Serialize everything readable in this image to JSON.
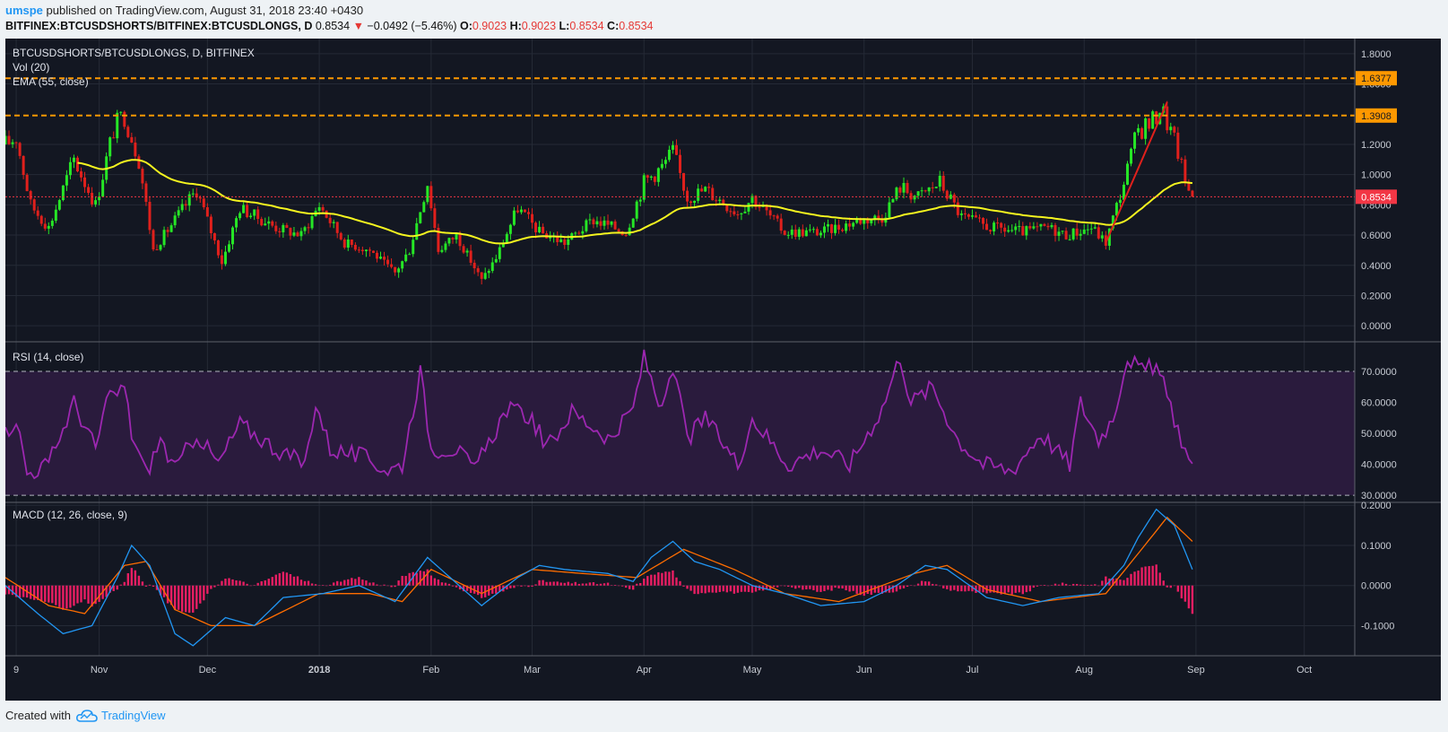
{
  "header": {
    "author": "umspe",
    "published_text": "published on TradingView.com, August 31, 2018 23:40 +0430",
    "symbol": "BITFINEX:BTCUSDSHORTS/BITFINEX:BTCUSDLONGS, D",
    "last": "0.8534",
    "change": "−0.0492 (−5.46%)",
    "o_label": "O:",
    "o_value": "0.9023",
    "h_label": "H:",
    "h_value": "0.9023",
    "l_label": "L:",
    "l_value": "0.8534",
    "c_label": "C:",
    "c_value": "0.8534"
  },
  "footer": {
    "created_with": "Created with",
    "brand": "TradingView"
  },
  "colors": {
    "background": "#131722",
    "up": "#26e626",
    "down": "#e0201c",
    "ema": "#f5f51f",
    "level": "#ff9800",
    "rsi": "#9c27b0",
    "rsi_band": "#2a1b3d",
    "macd": "#2196f3",
    "signal": "#ff6d00",
    "histogram": "#e91e63",
    "last_price": "#f23645"
  },
  "chart_data": [
    {
      "type": "candlestick",
      "title": "BTCUSDSHORTS/BTCUSDLONGS, D, BITFINEX",
      "indicators": [
        "Vol (20)",
        "EMA (55, close)"
      ],
      "x_ticks": [
        "9",
        "Nov",
        "Dec",
        "2018",
        "Feb",
        "Mar",
        "Apr",
        "May",
        "Jun",
        "Jul",
        "Aug",
        "Sep",
        "Oct"
      ],
      "y_ticks": [
        "1.8000",
        "1.6000",
        "1.2000",
        "1.0000",
        "0.8000",
        "0.6000",
        "0.4000",
        "0.2000",
        "0.0000"
      ],
      "ylim": [
        -0.1,
        1.9
      ],
      "horizontal_levels": [
        {
          "value": 1.6377,
          "label": "1.6377"
        },
        {
          "value": 1.3908,
          "label": "1.3908"
        }
      ],
      "last_price": {
        "value": 0.8534,
        "label": "0.8534"
      },
      "close_anchors": [
        [
          "2017-10-06",
          1.2
        ],
        [
          "2017-10-09",
          1.25
        ],
        [
          "2017-10-13",
          0.8
        ],
        [
          "2017-10-18",
          0.65
        ],
        [
          "2017-10-25",
          1.1
        ],
        [
          "2017-10-31",
          0.8
        ],
        [
          "2017-11-05",
          1.3
        ],
        [
          "2017-11-08",
          1.4
        ],
        [
          "2017-11-12",
          1.1
        ],
        [
          "2017-11-16",
          0.5
        ],
        [
          "2017-11-22",
          0.7
        ],
        [
          "2017-11-28",
          0.9
        ],
        [
          "2017-12-05",
          0.42
        ],
        [
          "2017-12-10",
          0.78
        ],
        [
          "2017-12-20",
          0.65
        ],
        [
          "2017-12-27",
          0.6
        ],
        [
          "2018-01-01",
          0.8
        ],
        [
          "2018-01-08",
          0.55
        ],
        [
          "2018-01-15",
          0.5
        ],
        [
          "2018-01-22",
          0.35
        ],
        [
          "2018-01-26",
          0.5
        ],
        [
          "2018-01-31",
          0.95
        ],
        [
          "2018-02-03",
          0.5
        ],
        [
          "2018-02-08",
          0.6
        ],
        [
          "2018-02-15",
          0.3
        ],
        [
          "2018-02-19",
          0.45
        ],
        [
          "2018-02-25",
          0.78
        ],
        [
          "2018-03-03",
          0.62
        ],
        [
          "2018-03-10",
          0.55
        ],
        [
          "2018-03-18",
          0.7
        ],
        [
          "2018-03-27",
          0.62
        ],
        [
          "2018-04-01",
          0.95
        ],
        [
          "2018-04-06",
          1.05
        ],
        [
          "2018-04-09",
          1.15
        ],
        [
          "2018-04-13",
          0.85
        ],
        [
          "2018-04-18",
          0.9
        ],
        [
          "2018-04-27",
          0.75
        ],
        [
          "2018-05-01",
          0.85
        ],
        [
          "2018-05-10",
          0.62
        ],
        [
          "2018-05-20",
          0.62
        ],
        [
          "2018-05-31",
          0.7
        ],
        [
          "2018-06-06",
          0.72
        ],
        [
          "2018-06-11",
          0.92
        ],
        [
          "2018-06-16",
          0.85
        ],
        [
          "2018-06-22",
          0.95
        ],
        [
          "2018-06-28",
          0.72
        ],
        [
          "2018-07-06",
          0.65
        ],
        [
          "2018-07-15",
          0.62
        ],
        [
          "2018-07-22",
          0.65
        ],
        [
          "2018-07-27",
          0.6
        ],
        [
          "2018-08-03",
          0.65
        ],
        [
          "2018-08-07",
          0.55
        ],
        [
          "2018-08-12",
          0.95
        ],
        [
          "2018-08-16",
          1.3
        ],
        [
          "2018-08-20",
          1.35
        ],
        [
          "2018-08-22",
          1.45
        ],
        [
          "2018-08-24",
          1.35
        ],
        [
          "2018-08-27",
          1.15
        ],
        [
          "2018-08-29",
          0.95
        ],
        [
          "2018-08-31",
          0.8534
        ]
      ],
      "trendline": {
        "from": [
          "2018-08-07",
          0.55
        ],
        "to": [
          "2018-08-24",
          1.48
        ]
      }
    },
    {
      "type": "line",
      "title": "RSI (14, close)",
      "y_ticks": [
        "70.0000",
        "60.0000",
        "50.0000",
        "40.0000",
        "30.0000"
      ],
      "ylim": [
        28,
        79
      ],
      "bands": [
        30,
        70
      ],
      "anchors": [
        [
          "2017-10-06",
          50
        ],
        [
          "2017-10-09",
          55
        ],
        [
          "2017-10-12",
          37
        ],
        [
          "2017-10-18",
          40
        ],
        [
          "2017-10-25",
          60
        ],
        [
          "2017-10-31",
          45
        ],
        [
          "2017-11-03",
          60
        ],
        [
          "2017-11-08",
          65
        ],
        [
          "2017-11-10",
          50
        ],
        [
          "2017-11-14",
          37
        ],
        [
          "2017-11-18",
          48
        ],
        [
          "2017-11-22",
          38
        ],
        [
          "2017-11-28",
          50
        ],
        [
          "2017-12-04",
          40
        ],
        [
          "2017-12-10",
          53
        ],
        [
          "2017-12-20",
          45
        ],
        [
          "2017-12-28",
          40
        ],
        [
          "2017-12-31",
          60
        ],
        [
          "2018-01-04",
          45
        ],
        [
          "2018-01-14",
          42
        ],
        [
          "2018-01-20",
          38
        ],
        [
          "2018-01-24",
          40
        ],
        [
          "2018-01-29",
          70
        ],
        [
          "2018-02-01",
          45
        ],
        [
          "2018-02-08",
          45
        ],
        [
          "2018-02-13",
          38
        ],
        [
          "2018-02-22",
          58
        ],
        [
          "2018-03-01",
          55
        ],
        [
          "2018-03-05",
          45
        ],
        [
          "2018-03-12",
          57
        ],
        [
          "2018-03-23",
          48
        ],
        [
          "2018-03-29",
          58
        ],
        [
          "2018-04-01",
          75
        ],
        [
          "2018-04-05",
          60
        ],
        [
          "2018-04-10",
          68
        ],
        [
          "2018-04-13",
          48
        ],
        [
          "2018-04-18",
          55
        ],
        [
          "2018-04-27",
          40
        ],
        [
          "2018-05-01",
          55
        ],
        [
          "2018-05-11",
          40
        ],
        [
          "2018-05-20",
          45
        ],
        [
          "2018-05-28",
          40
        ],
        [
          "2018-06-06",
          58
        ],
        [
          "2018-06-11",
          75
        ],
        [
          "2018-06-14",
          60
        ],
        [
          "2018-06-20",
          65
        ],
        [
          "2018-06-27",
          48
        ],
        [
          "2018-07-04",
          40
        ],
        [
          "2018-07-12",
          38
        ],
        [
          "2018-07-20",
          50
        ],
        [
          "2018-07-28",
          40
        ],
        [
          "2018-07-31",
          60
        ],
        [
          "2018-08-05",
          48
        ],
        [
          "2018-08-09",
          55
        ],
        [
          "2018-08-13",
          75
        ],
        [
          "2018-08-17",
          70
        ],
        [
          "2018-08-21",
          72
        ],
        [
          "2018-08-24",
          62
        ],
        [
          "2018-08-28",
          48
        ],
        [
          "2018-08-31",
          38
        ]
      ]
    },
    {
      "type": "macd",
      "title": "MACD (12, 26, close, 9)",
      "y_ticks": [
        "0.2000",
        "0.1000",
        "0.0000",
        "-0.1000"
      ],
      "ylim": [
        -0.175,
        0.205
      ],
      "macd_anchors": [
        [
          "2017-10-06",
          0.0
        ],
        [
          "2017-10-15",
          -0.07
        ],
        [
          "2017-10-22",
          -0.12
        ],
        [
          "2017-10-30",
          -0.1
        ],
        [
          "2017-11-06",
          0.02
        ],
        [
          "2017-11-10",
          0.1
        ],
        [
          "2017-11-15",
          0.05
        ],
        [
          "2017-11-22",
          -0.12
        ],
        [
          "2017-11-27",
          -0.15
        ],
        [
          "2017-12-06",
          -0.08
        ],
        [
          "2017-12-14",
          -0.1
        ],
        [
          "2017-12-22",
          -0.03
        ],
        [
          "2018-01-02",
          -0.02
        ],
        [
          "2018-01-12",
          0.0
        ],
        [
          "2018-01-22",
          -0.04
        ],
        [
          "2018-01-31",
          0.07
        ],
        [
          "2018-02-05",
          0.03
        ],
        [
          "2018-02-15",
          -0.05
        ],
        [
          "2018-02-25",
          0.02
        ],
        [
          "2018-03-03",
          0.05
        ],
        [
          "2018-03-10",
          0.04
        ],
        [
          "2018-03-22",
          0.03
        ],
        [
          "2018-03-29",
          0.01
        ],
        [
          "2018-04-03",
          0.07
        ],
        [
          "2018-04-09",
          0.11
        ],
        [
          "2018-04-15",
          0.06
        ],
        [
          "2018-04-22",
          0.04
        ],
        [
          "2018-05-01",
          0.0
        ],
        [
          "2018-05-10",
          -0.02
        ],
        [
          "2018-05-20",
          -0.05
        ],
        [
          "2018-06-01",
          -0.04
        ],
        [
          "2018-06-10",
          0.0
        ],
        [
          "2018-06-18",
          0.05
        ],
        [
          "2018-06-24",
          0.04
        ],
        [
          "2018-07-05",
          -0.03
        ],
        [
          "2018-07-15",
          -0.05
        ],
        [
          "2018-07-25",
          -0.03
        ],
        [
          "2018-08-05",
          -0.02
        ],
        [
          "2018-08-12",
          0.05
        ],
        [
          "2018-08-16",
          0.12
        ],
        [
          "2018-08-21",
          0.19
        ],
        [
          "2018-08-26",
          0.15
        ],
        [
          "2018-08-31",
          0.04
        ]
      ],
      "signal_anchors": [
        [
          "2017-10-06",
          0.02
        ],
        [
          "2017-10-18",
          -0.05
        ],
        [
          "2017-10-28",
          -0.07
        ],
        [
          "2017-11-08",
          0.05
        ],
        [
          "2017-11-14",
          0.06
        ],
        [
          "2017-11-22",
          -0.06
        ],
        [
          "2017-12-02",
          -0.1
        ],
        [
          "2017-12-14",
          -0.1
        ],
        [
          "2018-01-01",
          -0.02
        ],
        [
          "2018-01-15",
          -0.02
        ],
        [
          "2018-01-24",
          -0.04
        ],
        [
          "2018-02-01",
          0.04
        ],
        [
          "2018-02-15",
          -0.02
        ],
        [
          "2018-03-01",
          0.04
        ],
        [
          "2018-03-15",
          0.03
        ],
        [
          "2018-03-30",
          0.02
        ],
        [
          "2018-04-12",
          0.09
        ],
        [
          "2018-04-26",
          0.04
        ],
        [
          "2018-05-10",
          -0.02
        ],
        [
          "2018-05-25",
          -0.04
        ],
        [
          "2018-06-15",
          0.03
        ],
        [
          "2018-06-24",
          0.05
        ],
        [
          "2018-07-05",
          -0.01
        ],
        [
          "2018-07-20",
          -0.04
        ],
        [
          "2018-08-07",
          -0.02
        ],
        [
          "2018-08-16",
          0.08
        ],
        [
          "2018-08-24",
          0.17
        ],
        [
          "2018-08-31",
          0.11
        ]
      ]
    }
  ],
  "x_axis_start": "2017-10-06",
  "x_axis_end": "2018-10-15"
}
